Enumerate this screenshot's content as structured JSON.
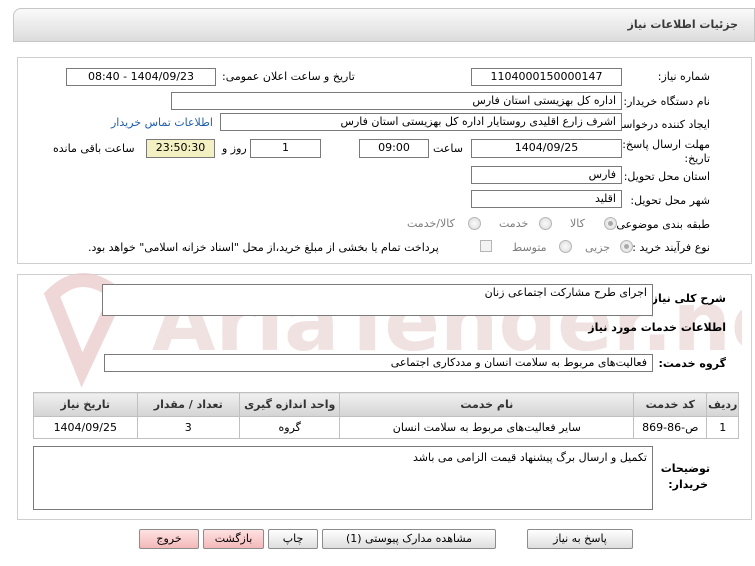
{
  "header": {
    "title": "جزئیات اطلاعات نیاز"
  },
  "form": {
    "need_number_label": "شماره نیاز:",
    "need_number": "1104000150000147",
    "announce_label": "تاریخ و ساعت اعلان عمومی:",
    "announce_value": "1404/09/23 - 08:40",
    "buyer_org_label": "نام دستگاه خریدار:",
    "buyer_org": "اداره کل بهزیستی استان فارس",
    "creator_label": "ایجاد کننده درخواست:",
    "creator": "اشرف زارع اقلیدی روستایار اداره کل بهزیستی استان فارس",
    "contact_link": "اطلاعات تماس خریدار",
    "deadline_label_1": "مهلت ارسال پاسخ: تا",
    "deadline_label_2": "تاریخ:",
    "deadline_date": "1404/09/25",
    "time_label": "ساعت",
    "deadline_time": "09:00",
    "days_value": "1",
    "days_label": "روز و",
    "remaining_time": "23:50:30",
    "remaining_label": "ساعت باقی مانده",
    "province_label": "استان محل تحویل:",
    "province": "فارس",
    "city_label": "شهر محل تحویل:",
    "city": "اقلید",
    "category_label": "طبقه بندی موضوعی:",
    "category_options": [
      "کالا",
      "خدمت",
      "کالا/خدمت"
    ],
    "purchase_type_label": "نوع فرآیند خرید :",
    "purchase_options": [
      "جزیی",
      "متوسط"
    ],
    "payment_note": "پرداخت تمام یا بخشی از مبلغ خرید،از محل \"اسناد خزانه اسلامی\" خواهد بود."
  },
  "need": {
    "summary_label": "شرح کلی نیاز:",
    "summary": "اجرای طرح مشارکت اجتماعی زنان",
    "services_title": "اطلاعات خدمات مورد نیاز",
    "service_group_label": "گروه خدمت:",
    "service_group": "فعالیت‌های مربوط به سلامت انسان و مددکاری اجتماعی"
  },
  "table": {
    "headers": [
      "ردیف",
      "کد خدمت",
      "نام خدمت",
      "واحد اندازه گیری",
      "تعداد / مقدار",
      "تاریخ نیاز"
    ],
    "rows": [
      [
        "1",
        "ص-86-869",
        "سایر فعالیت‌های مربوط به سلامت انسان",
        "گروه",
        "3",
        "1404/09/25"
      ]
    ]
  },
  "buyer_notes": {
    "label_1": "توضیحات",
    "label_2": "خریدار:",
    "text": "تکمیل و ارسال برگ پیشنهاد قیمت الزامی می باشد"
  },
  "buttons": {
    "reply": "پاسخ به نیاز",
    "attachments": "مشاهده مدارک پیوستی (1)",
    "print": "چاپ",
    "back": "بازگشت",
    "exit": "خروج"
  },
  "watermark": {
    "text": "AriaTender.net"
  },
  "colors": {
    "link": "#1d5fb8",
    "remaining_bg": "#f3f1c2",
    "watermark": "#e9caca"
  }
}
